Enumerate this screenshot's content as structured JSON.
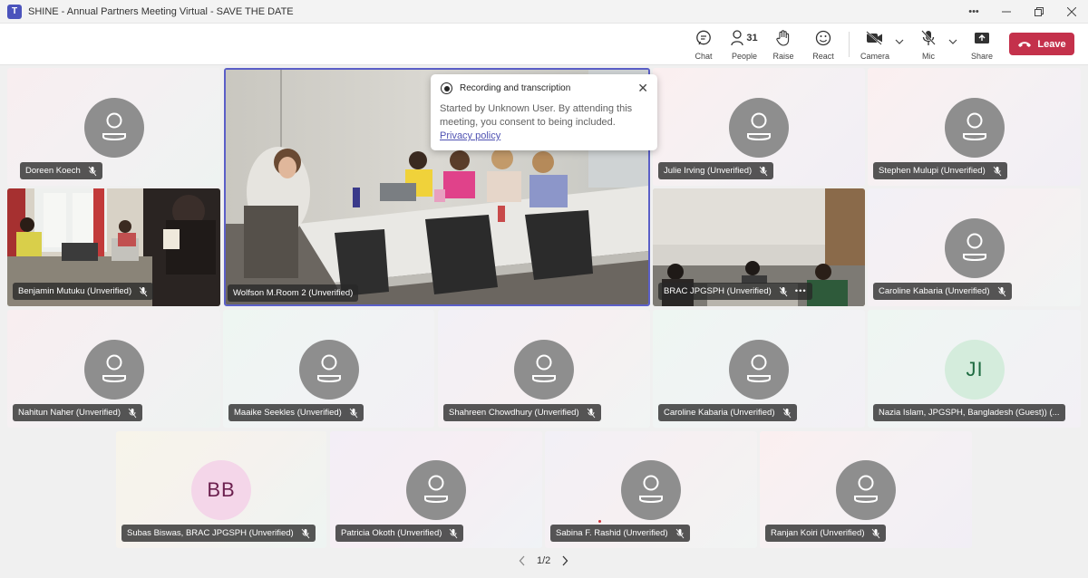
{
  "window": {
    "title": "SHINE - Annual Partners Meeting Virtual - SAVE THE DATE",
    "logo_letter": "T"
  },
  "toolbar": {
    "chat_label": "Chat",
    "people_label": "People",
    "people_count": "31",
    "raise_label": "Raise",
    "react_label": "React",
    "camera_label": "Camera",
    "mic_label": "Mic",
    "share_label": "Share",
    "leave_label": "Leave"
  },
  "recording_popup": {
    "title": "Recording and transcription",
    "body": "Started by Unknown User. By attending this meeting, you consent to being included.",
    "link": "Privacy policy"
  },
  "participants": [
    {
      "name": "Doreen Koech",
      "type": "avatar"
    },
    {
      "name": "Wolfson M.Room 2 (Unverified)",
      "type": "video"
    },
    {
      "name": "Julie Irving (Unverified)",
      "type": "avatar"
    },
    {
      "name": "Stephen Mulupi (Unverified)",
      "type": "avatar"
    },
    {
      "name": "Benjamin Mutuku (Unverified)",
      "type": "video"
    },
    {
      "name": "BRAC JPGSPH (Unverified)",
      "type": "video"
    },
    {
      "name": "Caroline Kabaria (Unverified)",
      "type": "avatar"
    },
    {
      "name": "Nahitun Naher (Unverified)",
      "type": "avatar"
    },
    {
      "name": "Maaike Seekles (Unverified)",
      "type": "avatar"
    },
    {
      "name": "Shahreen Chowdhury (Unverified)",
      "type": "avatar"
    },
    {
      "name": "Caroline Kabaria (Unverified)",
      "type": "avatar"
    },
    {
      "name": "Nazia Islam, JPGSPH, Bangladesh (Guest)) (...",
      "type": "initials",
      "initials": "JI"
    },
    {
      "name": "Subas Biswas, BRAC JPGSPH (Unverified)",
      "type": "initials",
      "initials": "BB"
    },
    {
      "name": "Patricia Okoth (Unverified)",
      "type": "avatar"
    },
    {
      "name": "Sabina F. Rashid (Unverified)",
      "type": "avatar"
    },
    {
      "name": "Ranjan Koiri (Unverified)",
      "type": "avatar"
    }
  ],
  "pagination": {
    "label": "1/2"
  },
  "colors": {
    "accent": "#5b5fc7",
    "leave": "#c4314b",
    "avatar_gray": "#8e8e8e",
    "ji_bg": "#d4ecdc",
    "ji_fg": "#1e6b41",
    "bb_bg": "#f4d6e9",
    "bb_fg": "#6b1f4e"
  }
}
